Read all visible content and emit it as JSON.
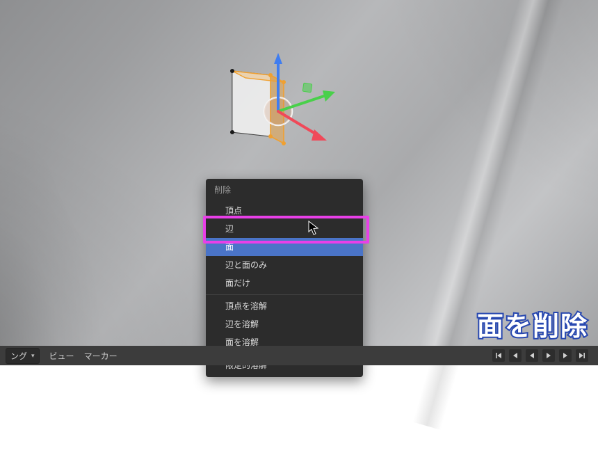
{
  "menu": {
    "title": "削除",
    "items": [
      {
        "label": "頂点",
        "hover": false
      },
      {
        "label": "辺",
        "hover": false
      },
      {
        "label": "面",
        "hover": true
      },
      {
        "label": "辺と面のみ",
        "hover": false
      },
      {
        "label": "面だけ",
        "hover": false
      },
      {
        "label": "頂点を溶解",
        "hover": false
      },
      {
        "label": "辺を溶解",
        "hover": false
      },
      {
        "label": "面を溶解",
        "hover": false
      },
      {
        "label": "限定的溶解",
        "hover": false
      }
    ]
  },
  "toolbar": {
    "dropdown_suffix": "ング",
    "view_label": "ビュー",
    "marker_label": "マーカー"
  },
  "caption": "面を削除",
  "gizmo": {
    "axes": [
      "x",
      "y",
      "z"
    ],
    "axis_colors": {
      "x": "#f04959",
      "y": "#49d04a",
      "z": "#3f7df0"
    },
    "selection_color": "#f0a030"
  }
}
